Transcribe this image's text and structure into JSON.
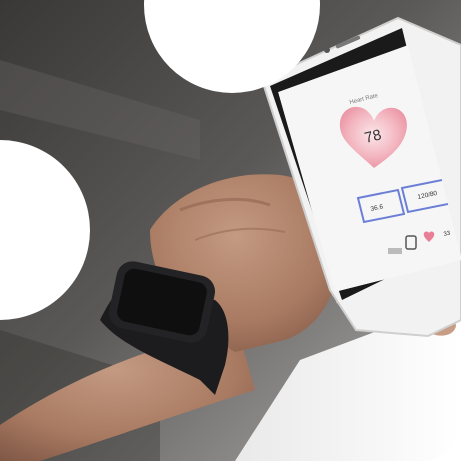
{
  "phone_screen": {
    "title": "Heart Rate",
    "heart_value": "78",
    "left_box_value": "36.6",
    "right_box_value": "120/80",
    "corner_value": "33"
  }
}
